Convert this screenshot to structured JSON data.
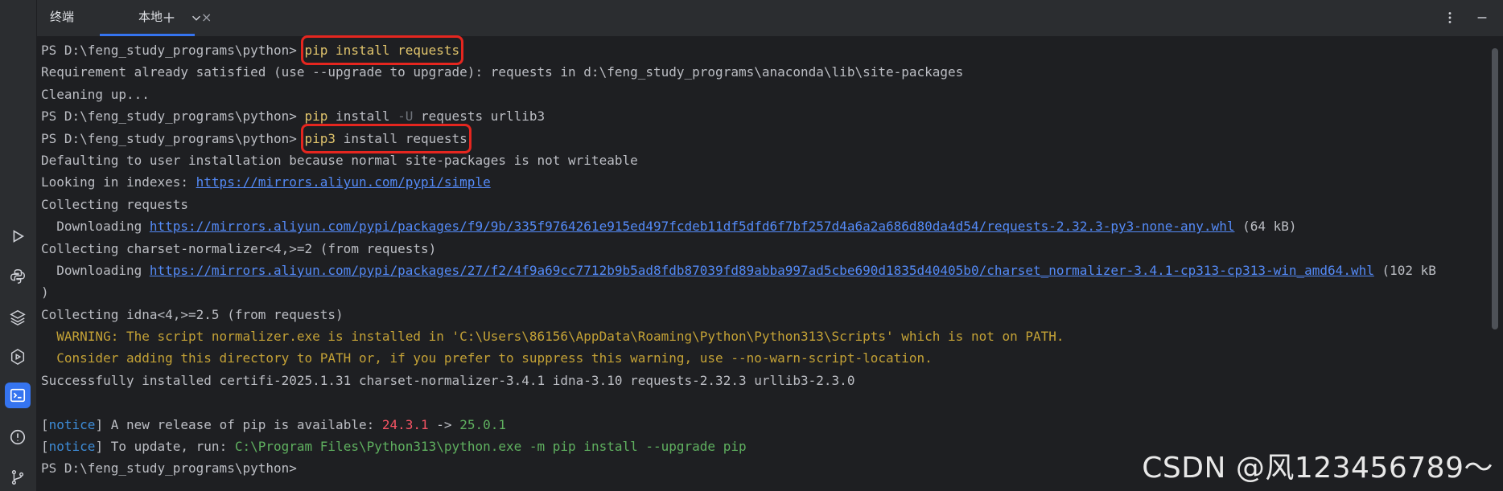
{
  "tabs": {
    "title": "终端",
    "local": "本地",
    "close_glyph": "×"
  },
  "prompt": "PS D:\\feng_study_programs\\python> ",
  "lines": {
    "l1_cmd": "pip install requests",
    "l2": "Requirement already satisfied (use --upgrade to upgrade): requests in d:\\feng_study_programs\\anaconda\\lib\\site-packages",
    "l3": "Cleaning up...",
    "l4_pip": "pip",
    "l4_install": " install ",
    "l4_flag": "-U",
    "l4_rest": " requests urllib3",
    "l5_pip3": "pip3",
    "l5_rest": " install requests",
    "l6": "Defaulting to user installation because normal site-packages is not writeable",
    "l7_text": "Looking in indexes: ",
    "l7_link": "https://mirrors.aliyun.com/pypi/simple",
    "l8": "Collecting requests",
    "l9_text": "  Downloading ",
    "l9_link": "https://mirrors.aliyun.com/pypi/packages/f9/9b/335f9764261e915ed497fcdeb11df5dfd6f7bf257d4a6a2a686d80da4d54/requests-2.32.3-py3-none-any.whl",
    "l9_size": " (64 kB)",
    "l10": "Collecting charset-normalizer<4,>=2 (from requests)",
    "l11_text": "  Downloading ",
    "l11_link": "https://mirrors.aliyun.com/pypi/packages/27/f2/4f9a69cc7712b9b5ad8fdb87039fd89abba997ad5cbe690d1835d40405b0/charset_normalizer-3.4.1-cp313-cp313-win_amd64.whl",
    "l11_size": " (102 kB",
    "l12": ")",
    "l13": "Collecting idna<4,>=2.5 (from requests)",
    "l14": "  WARNING: The script normalizer.exe is installed in 'C:\\Users\\86156\\AppData\\Roaming\\Python\\Python313\\Scripts' which is not on PATH.",
    "l15": "  Consider adding this directory to PATH or, if you prefer to suppress this warning, use --no-warn-script-location.",
    "l16": "Successfully installed certifi-2025.1.31 charset-normalizer-3.4.1 idna-3.10 requests-2.32.3 urllib3-2.3.0",
    "l18_open": "[",
    "l18_notice": "notice",
    "l18_mid": "] A new release of pip is available: ",
    "l18_old": "24.3.1",
    "l18_arrow": " -> ",
    "l18_new": "25.0.1",
    "l19_open": "[",
    "l19_notice": "notice",
    "l19_mid": "] To update, run: ",
    "l19_cmd": "C:\\Program Files\\Python313\\python.exe -m pip install --upgrade pip"
  },
  "watermark": "CSDN @风123456789～",
  "colors": {
    "background": "#1e1f22",
    "highlight_box": "#e5261f",
    "accent": "#3574f0"
  }
}
